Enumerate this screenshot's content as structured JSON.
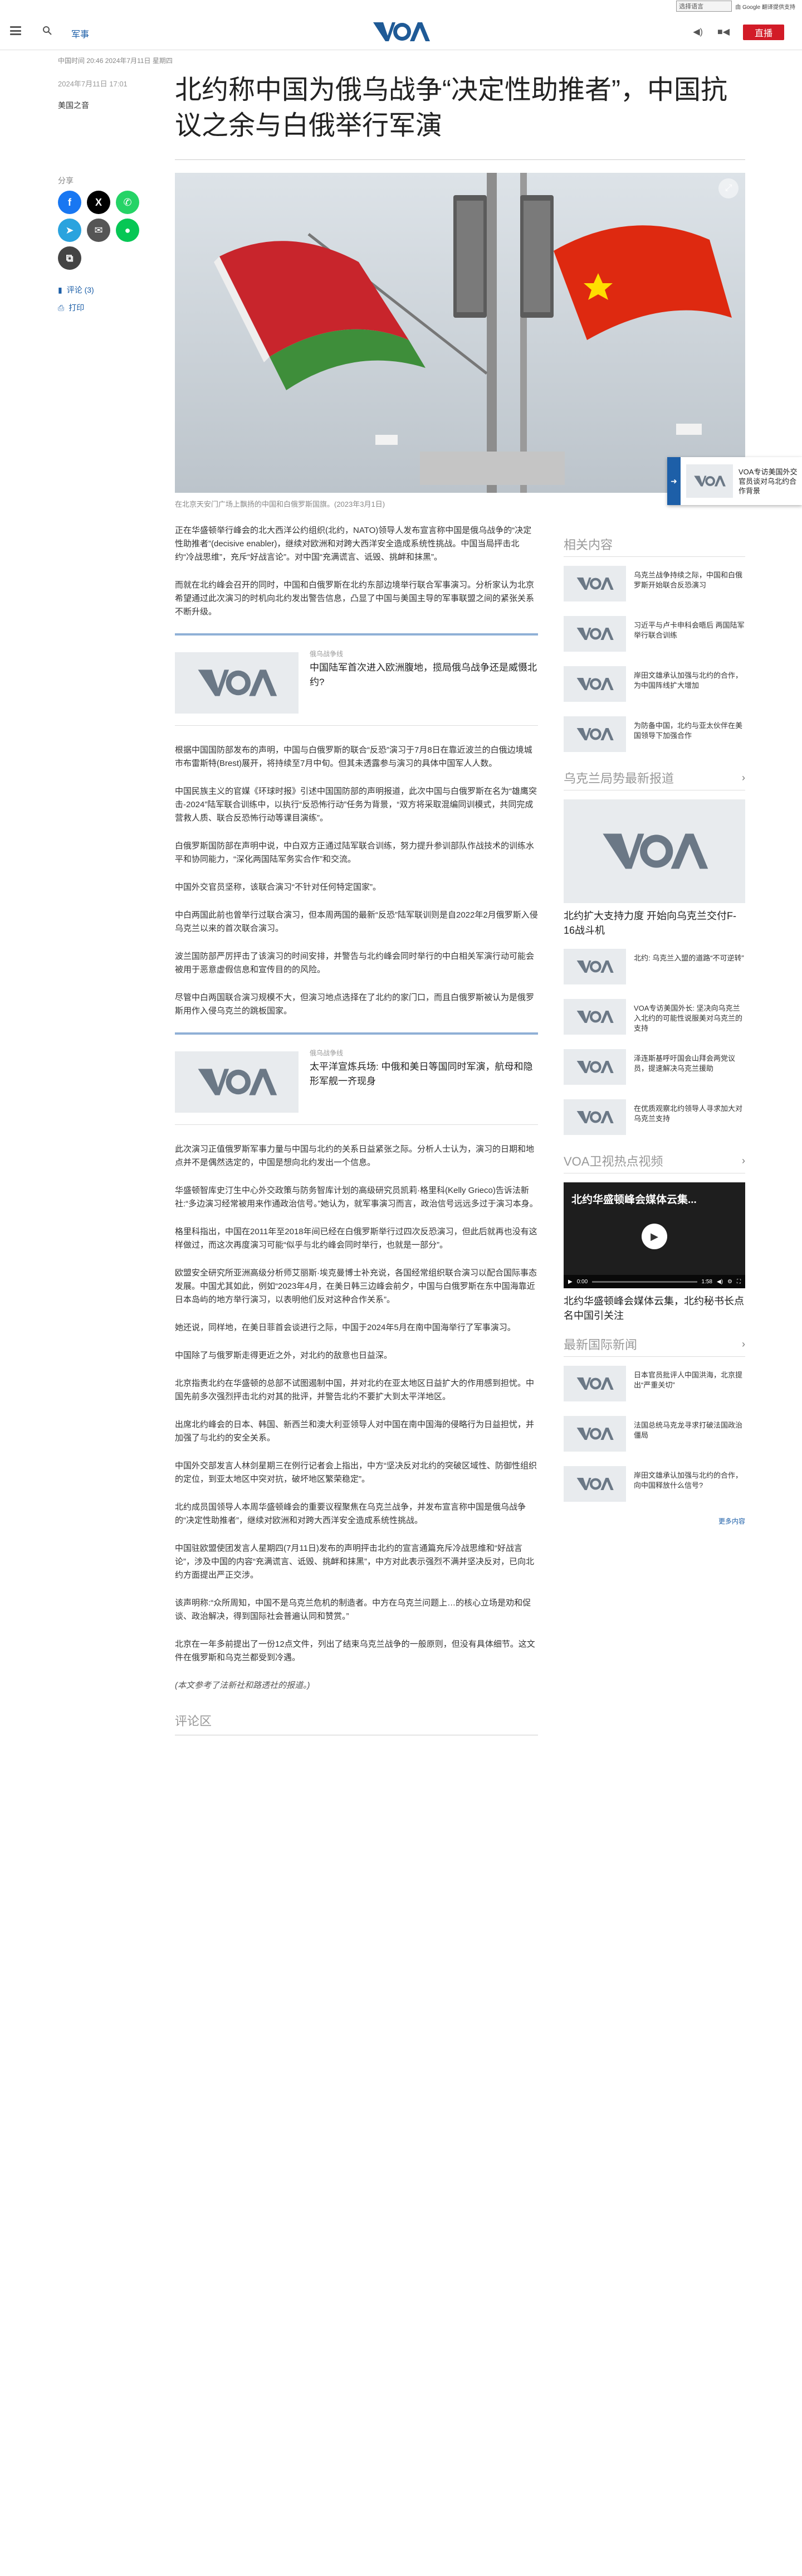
{
  "langbar": {
    "select_label": "选择语言",
    "powered": "由 Google 翻译提供支持"
  },
  "header": {
    "section": "军事",
    "live": "直播"
  },
  "kicker": "中国时间 20:46 2024年7月11日 星期四",
  "article": {
    "date": "2024年7月11日 17:01",
    "author": "美国之音",
    "title": "北约称中国为俄乌战争“决定性助推者”，中国抗议之余与白俄举行军演",
    "caption": "在北京天安门广场上飘扬的中国和白俄罗斯国旗。(2023年3月1日)",
    "paragraphs_a": [
      "正在华盛顿举行峰会的北大西洋公约组织(北约，NATO)领导人发布宣言称中国是俄乌战争的“决定性助推者”(decisive enabler)，继续对欧洲和对跨大西洋安全造成系统性挑战。中国当局抨击北约“冷战思维”，充斥“好战言论”。对中国“充满谎言、诋毁、挑衅和抹黑”。",
      "而就在北约峰会召开的同时，中国和白俄罗斯在北约东部边境举行联合军事演习。分析家认为北京希望通过此次演习的时机向北约发出警告信息，凸显了中国与美国主导的军事联盟之间的紧张关系不断升级。"
    ],
    "related_1": {
      "kicker": "俄乌战争线",
      "title": "中国陆军首次进入欧洲腹地，揽局俄乌战争还是威慑北约?"
    },
    "paragraphs_b": [
      "根据中国国防部发布的声明，中国与白俄罗斯的联合“反恐”演习于7月8日在靠近波兰的白俄边境城市布雷斯特(Brest)展开，将持续至7月中旬。但其未透露参与演习的具体中国军人人数。",
      "中国民族主义的官媒《环球时报》引述中国国防部的声明报道，此次中国与白俄罗斯在名为“雄鹰突击-2024”陆军联合训练中，以执行“反恐怖行动”任务为背景，“双方将采取混编同训模式，共同完成营救人质、联合反恐怖行动等课目演练”。",
      "白俄罗斯国防部在声明中说，中白双方正通过陆军联合训练，努力提升参训部队作战技术的训练水平和协同能力，“深化两国陆军务实合作”和交流。",
      "中国外交官员坚称，该联合演习“不针对任何特定国家”。",
      "中白两国此前也曾举行过联合演习，但本周两国的最新“反恐”陆军联训则是自2022年2月俄罗斯入侵乌克兰以来的首次联合演习。",
      "波兰国防部严厉抨击了该演习的时间安排，并警告与北约峰会同时举行的中白相关军演行动可能会被用于恶意虚假信息和宣传目的的风险。",
      "尽管中白两国联合演习规模不大，但演习地点选择在了北约的家门口，而且白俄罗斯被认为是俄罗斯用作入侵乌克兰的跳板国家。"
    ],
    "related_2": {
      "kicker": "俄乌战争线",
      "title": "太平洋宣炼兵场: 中俄和美日等国同时军演，航母和隐形军舰一齐现身"
    },
    "paragraphs_c": [
      "此次演习正值俄罗斯军事力量与中国与北约的关系日益紧张之际。分析人士认为，演习的日期和地点并不是偶然选定的，中国是想向北约发出一个信息。",
      "华盛顿智库史汀生中心外交政策与防务智库计划的高级研究员凯莉·格里科(Kelly Grieco)告诉法新社:“多边演习经常被用来作通政治信号。”她认为，就军事演习而言，政治信号远远多过于演习本身。",
      "格里科指出，中国在2011年至2018年间已经在白俄罗斯举行过四次反恐演习，但此后就再也没有这样做过，而这次再度演习可能“似乎与北约峰会同时举行，也就是一部分”。",
      "欧盟安全研究所亚洲高级分析师艾丽斯·埃克曼博士补充说，各国经常组织联合演习以配合国际事态发展。中国尤其如此，例如“2023年4月，在美日韩三边峰会前夕，中国与白俄罗斯在东中国海靠近日本岛屿的地方举行演习，以表明他们反对这种合作关系”。",
      "她还说，同样地，在美日菲首会谈进行之际，中国于2024年5月在南中国海举行了军事演习。",
      "中国除了与俄罗斯走得更近之外，对北约的敌意也日益深。",
      "北京指责北约在华盛顿的总部不试图遏制中国，并对北约在亚太地区日益扩大的作用感到担忧。中国先前多次强烈抨击北约对其的批评，并警告北约不要扩大到太平洋地区。",
      "出席北约峰会的日本、韩国、新西兰和澳大利亚领导人对中国在南中国海的侵略行为日益担忧，并加强了与北约的安全关系。",
      "中国外交部发言人林剑星期三在例行记者会上指出，中方“坚决反对北约的突破区域性、防御性组织的定位，到亚太地区中突对抗，破坏地区繁荣稳定”。",
      "北约成员国领导人本周华盛顿峰会的重要议程聚焦在乌克兰战争，并发布宣言称中国是俄乌战争的“决定性助推者”，继续对欧洲和对跨大西洋安全造成系统性挑战。",
      "中国驻欧盟使团发言人星期四(7月11日)发布的声明抨击北约的宣言通篇充斥冷战思维和“好战言论”，涉及中国的内容“充满谎言、诋毁、挑衅和抹黑”，中方对此表示强烈不满并坚决反对，已向北约方面提出严正交涉。",
      "该声明称:“众所周知，中国不是乌克兰危机的制造者。中方在乌克兰问题上…的核心立场是劝和促谈、政治解决，得到国际社会普遍认同和赞赏。”",
      "北京在一年多前提出了一份12点文件，列出了结束乌克兰战争的一般原则，但没有具体细节。这文件在俄罗斯和乌克兰都受到冷遇。"
    ],
    "note": "(本文参考了法新社和路透社的报道。)",
    "comments": "评论区"
  },
  "share": {
    "label": "分享",
    "comments_link": "评论 (3)",
    "print_link": "打印"
  },
  "sticky": {
    "text": "VOA专访美国外交官员谈对乌北约合作背景"
  },
  "sidebar": {
    "related_title": "相关内容",
    "related": [
      "乌克兰战争持续之际，中国和白俄罗斯开始联合反恐演习",
      "习近平与卢卡申科会晤后 两国陆军举行联合训练",
      "岸田文雄承认加强与北约的合作，为中国阵线扩大增加",
      "为防备中国，北约与亚太伙伴在美国领导下加强合作"
    ],
    "ukraine_title": "乌克兰局势最新报道",
    "ukraine_big": "北约扩大支持力度 开始向乌克兰交付F-16战斗机",
    "ukraine": [
      "北约: 乌克兰入盟的道路“不可逆转”",
      "VOA专访美国外长: 坚决向乌克兰入北约的可能性说服美对乌克兰的支持",
      "泽连斯基呼吁国会山拜会两党议员，提速解决乌克兰援助",
      "在优质观察北约领导人寻求加大对乌克兰支持"
    ],
    "video_title": "VOA卫视热点视频",
    "video_overlay": "北约华盛顿峰会媒体云集...",
    "video_time": "0:00",
    "video_dur": "1:58",
    "video_caption": "北约华盛顿峰会媒体云集，北约秘书长点名中国引关注",
    "intl_title": "最新国际新闻",
    "intl": [
      "日本官员批评人中国洪海，北京提出“严重关切”",
      "法国总统马克龙寻求打破法国政治僵局",
      "岸田文雄承认加强与北约的合作，向中国释放什么信号?"
    ],
    "more": "更多内容"
  }
}
